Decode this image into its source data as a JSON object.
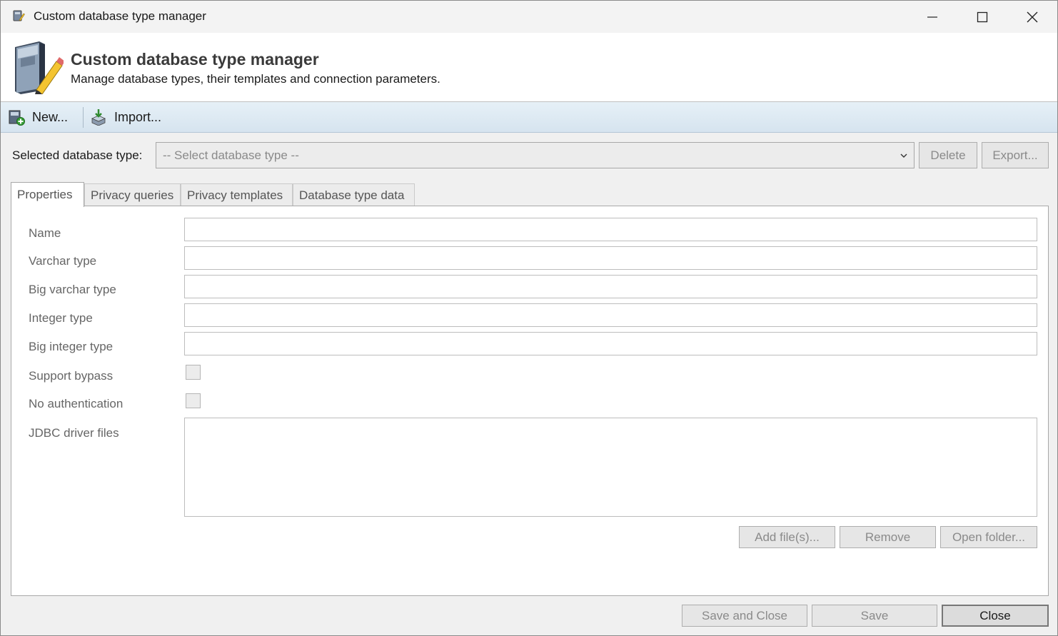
{
  "window": {
    "title": "Custom database type manager",
    "icons": [
      "app-icon",
      "minimize-icon",
      "maximize-icon",
      "close-icon"
    ]
  },
  "header": {
    "title": "Custom database type manager",
    "subtitle": "Manage database types, their templates and connection parameters.",
    "icon": "database-edit-icon"
  },
  "toolbar": {
    "new_label": "New...",
    "new_icon": "new-database-icon",
    "import_label": "Import...",
    "import_icon": "import-icon"
  },
  "selector": {
    "label": "Selected database type:",
    "placeholder": "-- Select database type --",
    "delete_label": "Delete",
    "export_label": "Export..."
  },
  "tabs": [
    {
      "label": "Properties",
      "active": true
    },
    {
      "label": "Privacy queries",
      "active": false
    },
    {
      "label": "Privacy templates",
      "active": false
    },
    {
      "label": "Database type data",
      "active": false
    }
  ],
  "properties": {
    "name_label": "Name",
    "name_value": "",
    "varchar_label": "Varchar type",
    "varchar_value": "",
    "big_varchar_label": "Big varchar type",
    "big_varchar_value": "",
    "integer_label": "Integer type",
    "integer_value": "",
    "big_integer_label": "Big integer type",
    "big_integer_value": "",
    "support_bypass_label": "Support bypass",
    "support_bypass_checked": false,
    "no_auth_label": "No authentication",
    "no_auth_checked": false,
    "jdbc_label": "JDBC driver files",
    "jdbc_files": [],
    "add_files_label": "Add file(s)...",
    "remove_label": "Remove",
    "open_folder_label": "Open folder..."
  },
  "footer": {
    "save_close_label": "Save and Close",
    "save_label": "Save",
    "close_label": "Close"
  },
  "colors": {
    "toolbar_bg": "#dae7f1",
    "disabled_text": "#8a8a8a",
    "header_title": "#3a3a3a"
  }
}
